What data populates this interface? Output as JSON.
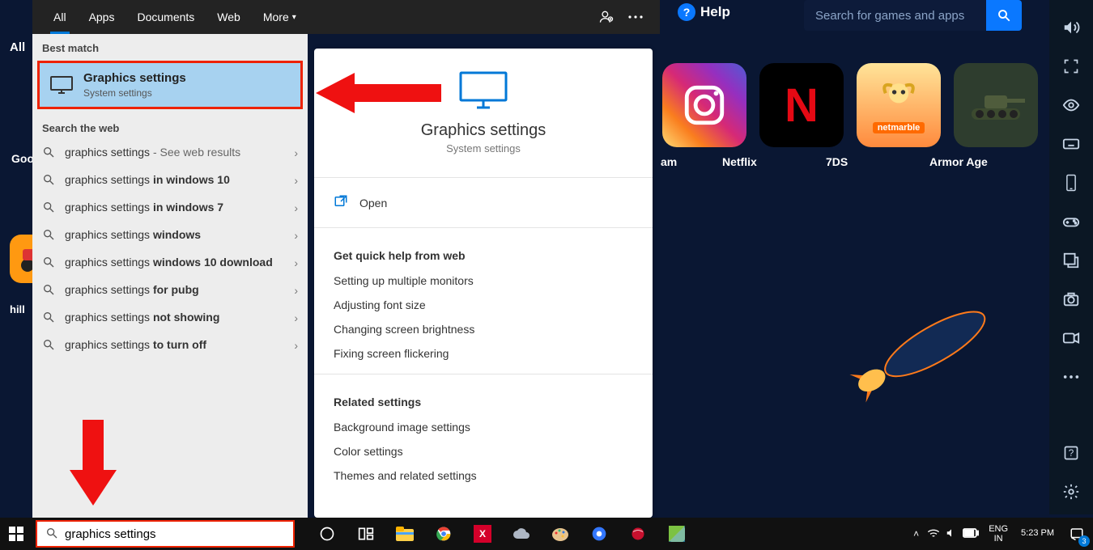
{
  "tabs": {
    "all": "All",
    "apps": "Apps",
    "docs": "Documents",
    "web": "Web",
    "more": "More"
  },
  "sections": {
    "bestmatch": "Best match",
    "searchweb": "Search the web"
  },
  "best": {
    "title": "Graphics settings",
    "sub": "System settings"
  },
  "webresults": [
    {
      "pre": "graphics settings",
      "bold": "",
      "suffix": " - See web results"
    },
    {
      "pre": "graphics settings ",
      "bold": "in windows 10",
      "suffix": ""
    },
    {
      "pre": "graphics settings ",
      "bold": "in windows 7",
      "suffix": ""
    },
    {
      "pre": "graphics settings ",
      "bold": "windows",
      "suffix": ""
    },
    {
      "pre": "graphics settings ",
      "bold": "windows 10 download",
      "suffix": ""
    },
    {
      "pre": "graphics settings ",
      "bold": "for pubg",
      "suffix": ""
    },
    {
      "pre": "graphics settings ",
      "bold": "not showing",
      "suffix": ""
    },
    {
      "pre": "graphics settings ",
      "bold": "to turn off",
      "suffix": ""
    }
  ],
  "detail": {
    "title": "Graphics settings",
    "sub": "System settings",
    "open": "Open",
    "helphdr": "Get quick help from web",
    "help": [
      "Setting up multiple monitors",
      "Adjusting font size",
      "Changing screen brightness",
      "Fixing screen flickering"
    ],
    "relhdr": "Related settings",
    "related": [
      "Background image settings",
      "Color settings",
      "Themes and related settings"
    ]
  },
  "apps": {
    "instagram_char": "",
    "netflix_char": "N",
    "netmarble": "netmarble",
    "labels": {
      "am": "am",
      "netflix": "Netflix",
      "sevends": "7DS",
      "armor": "Armor Age",
      "hill": "hill",
      "goo": "Goo",
      "all": "All"
    }
  },
  "help_label": "Help",
  "search_placeholder": "Search for games and apps",
  "taskbar": {
    "query": "graphics settings",
    "lang1": "ENG",
    "lang2": "IN",
    "time": "5:23 PM",
    "notif_count": "3"
  }
}
